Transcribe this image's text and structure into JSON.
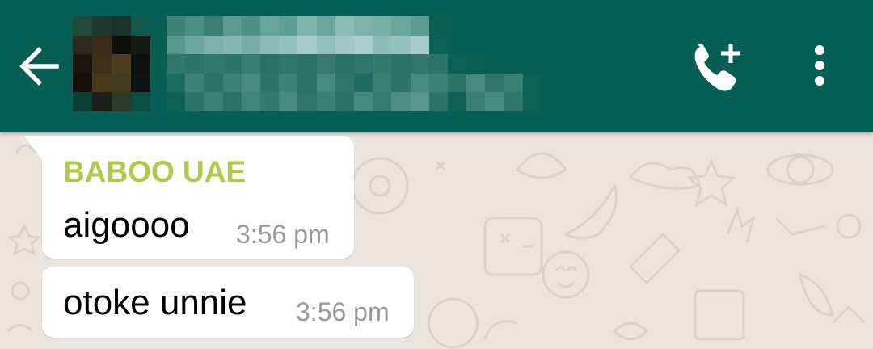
{
  "theme": {
    "header_color": "#075e54",
    "chat_background": "#ece5dd",
    "sender_color": "#afc94a",
    "time_color": "#9a9a9a"
  },
  "header": {
    "back_icon": "arrow-left-icon",
    "avatar": "pixelated-avatar",
    "title": "",
    "call_icon": "add-call-icon",
    "menu_icon": "more-vert-icon"
  },
  "messages": [
    {
      "sender": "BABOO UAE",
      "text": "aigoooo",
      "time": "3:56 pm"
    },
    {
      "text": "otoke unnie",
      "time": "3:56 pm"
    }
  ]
}
